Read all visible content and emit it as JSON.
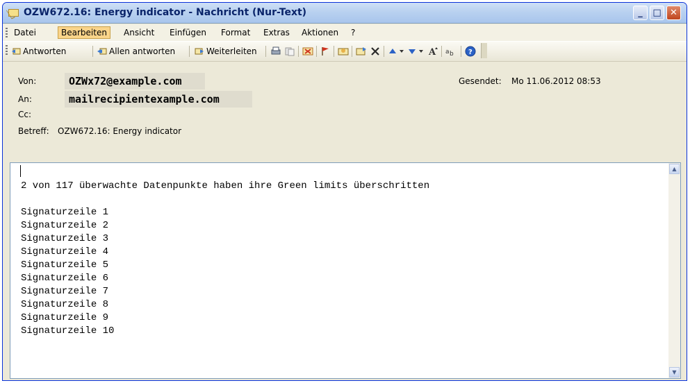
{
  "window": {
    "title": "OZW672.16: Energy indicator - Nachricht (Nur-Text)",
    "controls": {
      "minimize": "_",
      "maximize": "□",
      "close": "✕"
    }
  },
  "menu": {
    "items": [
      "Datei",
      "Bearbeiten",
      "Ansicht",
      "Einfügen",
      "Format",
      "Extras",
      "Aktionen",
      "?"
    ]
  },
  "toolbar": {
    "reply": "Antworten",
    "reply_all": "Allen antworten",
    "forward": "Weiterleiten"
  },
  "header": {
    "from_label": "Von:",
    "from_value": "OZWx72@example.com",
    "to_label": "An:",
    "to_value": "mailrecipientexample.com",
    "cc_label": "Cc:",
    "subject_label": "Betreff:",
    "subject_value": "OZW672.16: Energy indicator",
    "sent_label": "Gesendet:",
    "sent_value": "Mo 11.06.2012 08:53"
  },
  "body": {
    "text": "2 von 117 überwachte Datenpunkte haben ihre Green limits überschritten\n\nSignaturzeile 1\nSignaturzeile 2\nSignaturzeile 3\nSignaturzeile 4\nSignaturzeile 5\nSignaturzeile 6\nSignaturzeile 7\nSignaturzeile 8\nSignaturzeile 9\nSignaturzeile 10"
  },
  "colors": {
    "titlebar": "#b9d1f0",
    "title_text": "#0a246a",
    "menu_active": "#fad48a",
    "close_button": "#c0451e"
  }
}
